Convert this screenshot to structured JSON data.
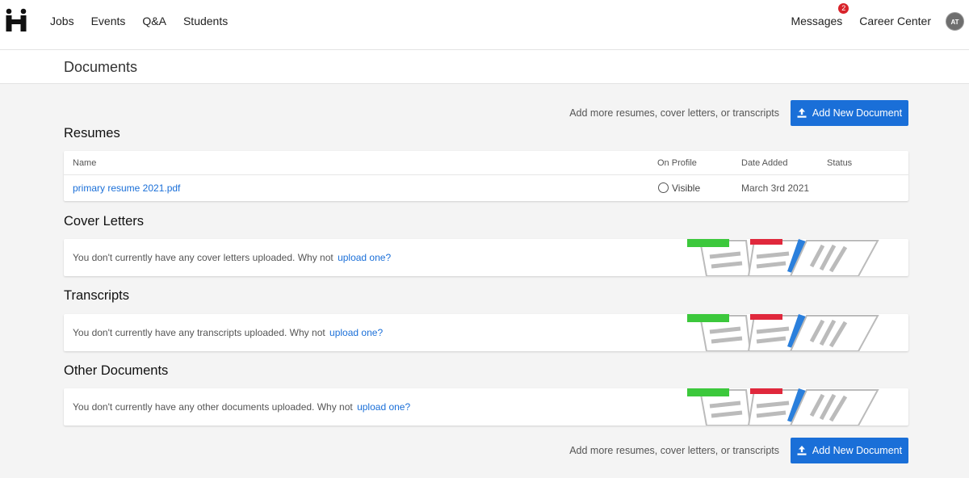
{
  "nav": {
    "links": [
      "Jobs",
      "Events",
      "Q&A",
      "Students"
    ],
    "messages_label": "Messages",
    "messages_count": "2",
    "career_center_label": "Career Center",
    "avatar_initials": "AT"
  },
  "page": {
    "title": "Documents"
  },
  "add_section": {
    "hint": "Add more resumes, cover letters, or transcripts",
    "button_label": "Add New Document"
  },
  "resumes": {
    "title": "Resumes",
    "columns": [
      "Name",
      "On Profile",
      "Date Added",
      "Status"
    ],
    "rows": [
      {
        "name": "primary resume 2021.pdf",
        "on_profile": "Visible",
        "date_added": "March 3rd 2021",
        "status": ""
      }
    ]
  },
  "cover_letters": {
    "title": "Cover Letters",
    "empty_text": "You don't currently have any cover letters uploaded. Why not",
    "upload_link": "upload one?"
  },
  "transcripts": {
    "title": "Transcripts",
    "empty_text": "You don't currently have any transcripts uploaded. Why not",
    "upload_link": "upload one?"
  },
  "other_documents": {
    "title": "Other Documents",
    "empty_text": "You don't currently have any other documents uploaded. Why not",
    "upload_link": "upload one?"
  },
  "colors": {
    "accent": "#1a6fd8",
    "badge": "#d8232a",
    "tab_green": "#3cc83c",
    "tab_red": "#e0283c",
    "tab_blue": "#2a7fdc"
  }
}
